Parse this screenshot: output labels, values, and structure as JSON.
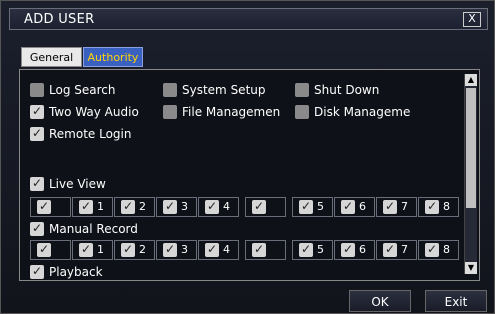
{
  "window": {
    "title": "ADD USER",
    "close_label": "X"
  },
  "tabs": [
    {
      "label": "General"
    },
    {
      "label": "Authority"
    }
  ],
  "permissions": {
    "log_search": "Log Search",
    "system_setup": "System Setup",
    "shut_down": "Shut Down",
    "two_way_audio": "Two Way Audio",
    "file_management": "File Managemen",
    "disk_management": "Disk Manageme",
    "remote_login": "Remote Login"
  },
  "sections": {
    "live_view": "Live View",
    "manual_record": "Manual Record",
    "playback": "Playback"
  },
  "channels": [
    "",
    "1",
    "2",
    "3",
    "4",
    "",
    "5",
    "6",
    "7",
    "8"
  ],
  "buttons": {
    "ok": "OK",
    "exit": "Exit"
  }
}
